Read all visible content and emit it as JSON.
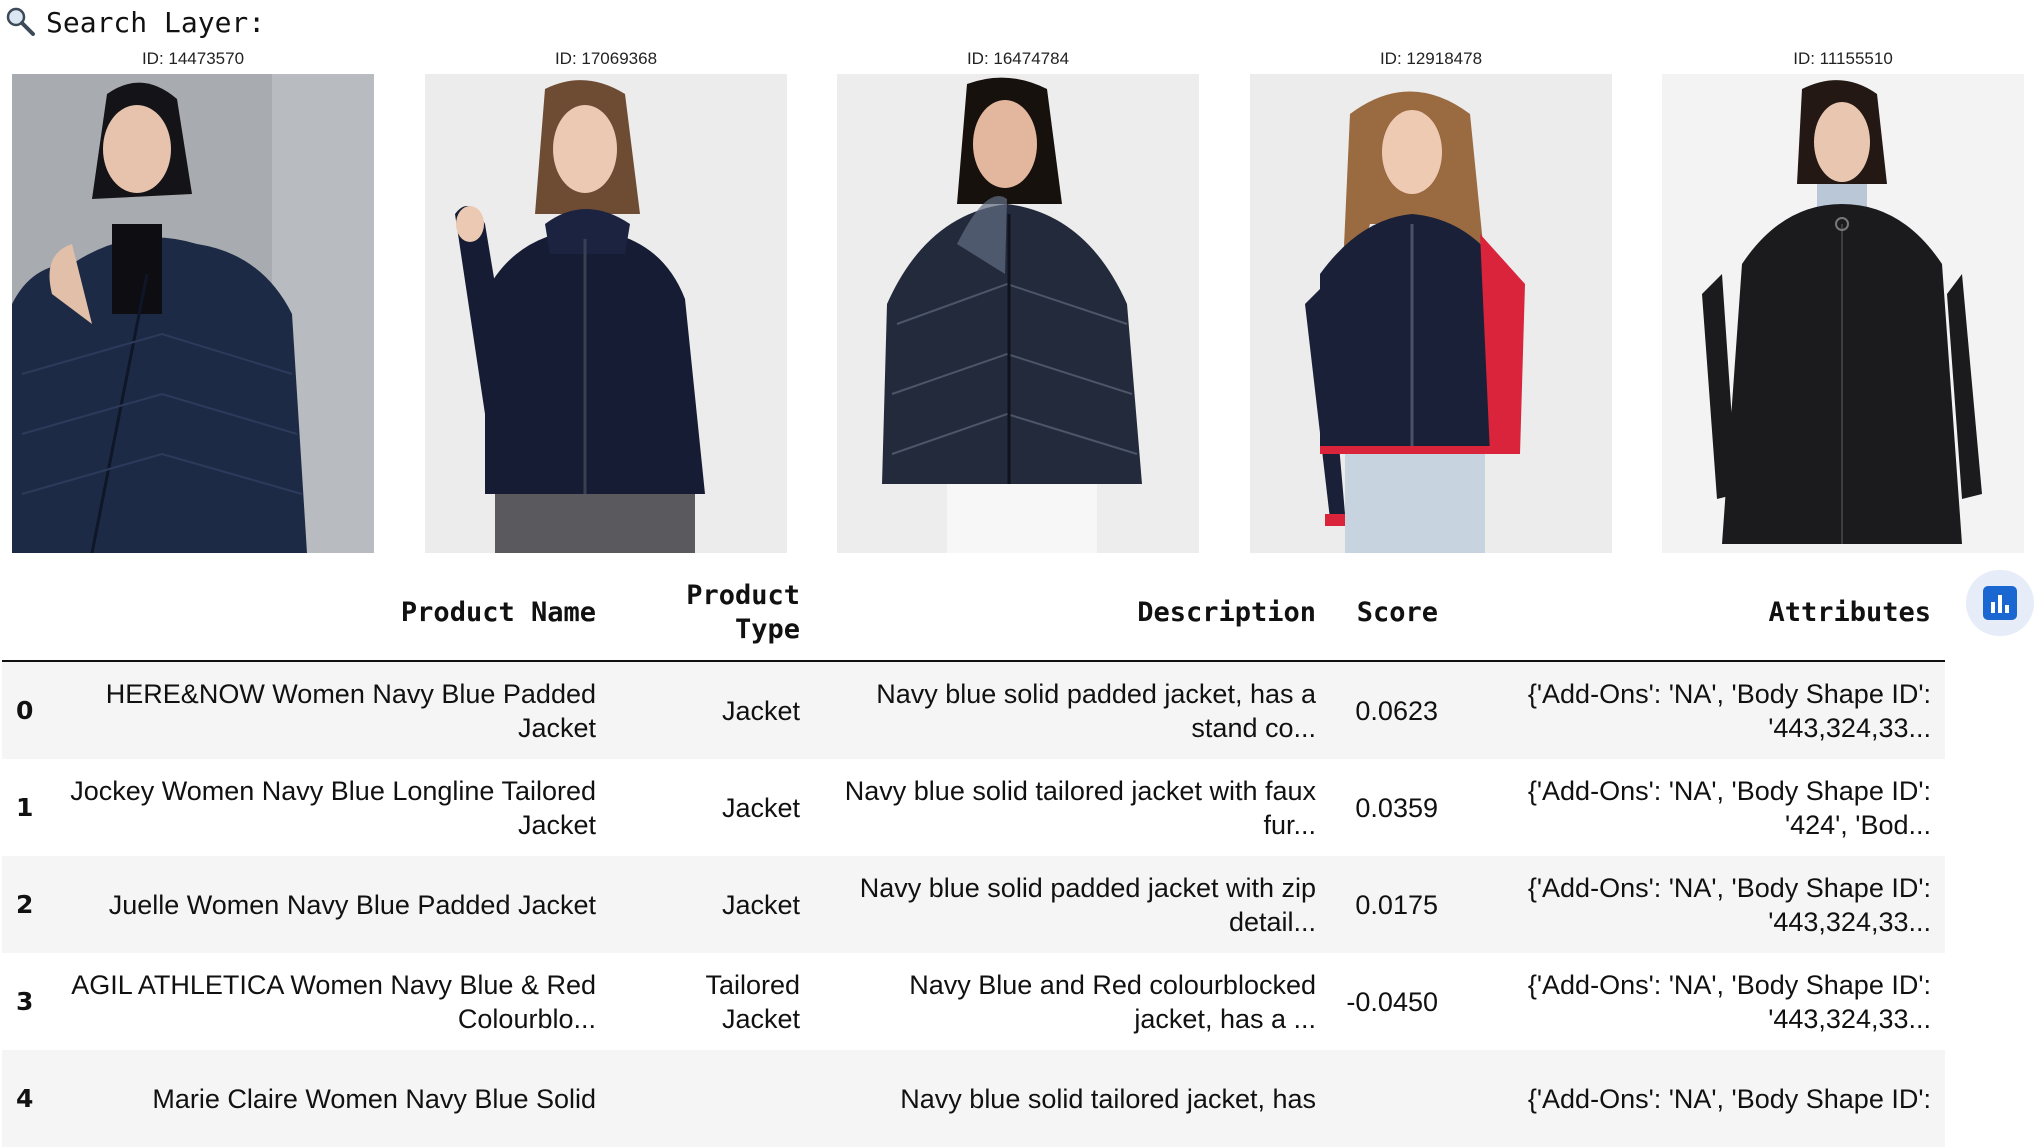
{
  "header": {
    "icon": "magnifier-icon",
    "title": "Search Layer:"
  },
  "results": [
    {
      "id_label": "ID: 14473570",
      "image": "woman-navy-quilted-padded-jacket-photo"
    },
    {
      "id_label": "ID: 17069368",
      "image": "woman-navy-hooded-tailored-jacket-photo"
    },
    {
      "id_label": "ID: 16474784",
      "image": "woman-navy-shiny-puffer-jacket-photo"
    },
    {
      "id_label": "ID: 12918478",
      "image": "woman-navy-red-colourblocked-jacket-photo"
    },
    {
      "id_label": "ID: 11155510",
      "image": "woman-black-longline-coat-photo"
    }
  ],
  "table": {
    "columns": [
      "",
      "Product Name",
      "Product Type",
      "Description",
      "Score",
      "Attributes"
    ],
    "rows": [
      {
        "index": "0",
        "name": "HERE&NOW Women Navy Blue Padded Jacket",
        "type": "Jacket",
        "description": "Navy blue solid padded jacket, has a stand co...",
        "score": "0.0623",
        "attributes": "{'Add-Ons': 'NA', 'Body Shape ID': '443,324,33..."
      },
      {
        "index": "1",
        "name": "Jockey Women Navy Blue Longline Tailored Jacket",
        "type": "Jacket",
        "description": "Navy blue solid tailored jacket with faux fur...",
        "score": "0.0359",
        "attributes": "{'Add-Ons': 'NA', 'Body Shape ID': '424', 'Bod..."
      },
      {
        "index": "2",
        "name": "Juelle Women Navy Blue Padded Jacket",
        "type": "Jacket",
        "description": "Navy blue solid padded jacket with zip detail...",
        "score": "0.0175",
        "attributes": "{'Add-Ons': 'NA', 'Body Shape ID': '443,324,33..."
      },
      {
        "index": "3",
        "name": "AGIL ATHLETICA Women Navy Blue & Red Colourblo...",
        "type": "Tailored Jacket",
        "description": "Navy Blue and Red colourblocked jacket, has a ...",
        "score": "-0.0450",
        "attributes": "{'Add-Ons': 'NA', 'Body Shape ID': '443,324,33..."
      },
      {
        "index": "4",
        "name": "Marie Claire Women Navy Blue Solid",
        "type": "",
        "description": "Navy blue solid tailored jacket, has",
        "score": "",
        "attributes": "{'Add-Ons': 'NA', 'Body Shape ID':"
      }
    ]
  },
  "fab": {
    "icon": "bar-chart-icon",
    "color": "#1a67d2"
  }
}
